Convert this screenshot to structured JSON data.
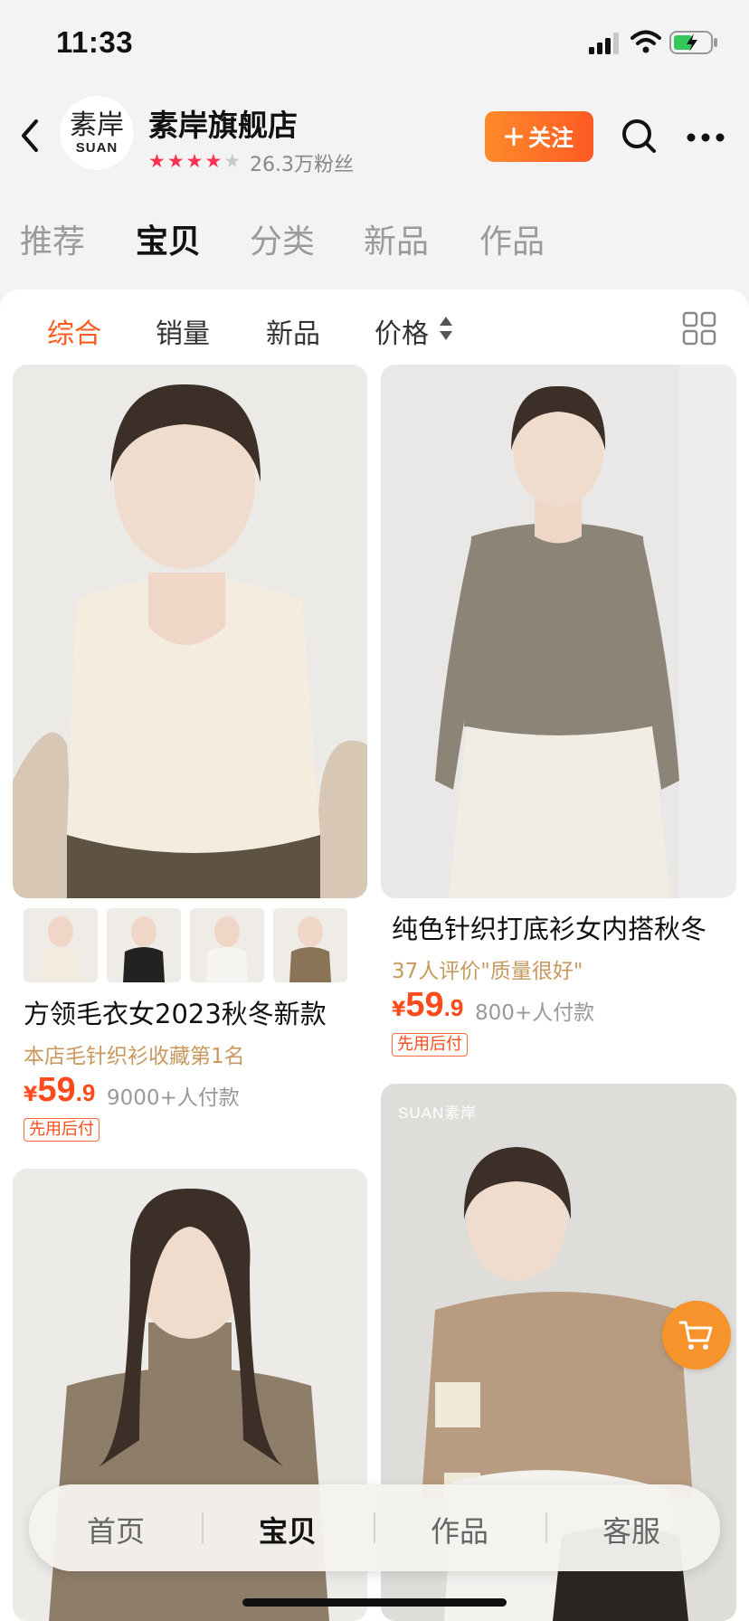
{
  "status_bar": {
    "time": "11:33"
  },
  "store": {
    "logo_cn": "素岸",
    "logo_en": "SUAN",
    "name": "素岸旗舰店",
    "rating_stars": 4,
    "fans": "26.3万粉丝",
    "follow_label": "关注"
  },
  "top_tabs": [
    {
      "label": "推荐",
      "active": false
    },
    {
      "label": "宝贝",
      "active": true
    },
    {
      "label": "分类",
      "active": false
    },
    {
      "label": "新品",
      "active": false
    },
    {
      "label": "作品",
      "active": false
    }
  ],
  "sort_bar": [
    {
      "label": "综合",
      "active": true
    },
    {
      "label": "销量",
      "active": false
    },
    {
      "label": "新品",
      "active": false
    },
    {
      "label": "价格",
      "active": false
    }
  ],
  "products": [
    {
      "title": "方领毛衣女2023秋冬新款",
      "subtitle": "本店毛针织衫收藏第1名",
      "price_symbol": "¥",
      "price_int": "59",
      "price_dec": ".9",
      "paid": "9000+人付款",
      "tag": "先用后付"
    },
    {
      "title": "纯色针织打底衫女内搭秋冬",
      "subtitle": "37人评价\"质量很好\"",
      "price_symbol": "¥",
      "price_int": "59",
      "price_dec": ".9",
      "paid": "800+人付款",
      "tag": "先用后付"
    },
    {
      "watermark": "SUAN素岸"
    }
  ],
  "bottom_nav": [
    {
      "label": "首页",
      "active": false
    },
    {
      "label": "宝贝",
      "active": true
    },
    {
      "label": "作品",
      "active": false
    },
    {
      "label": "客服",
      "active": false
    }
  ],
  "colors": {
    "accent": "#ff5a1f",
    "price": "#ff4a1c",
    "star": "#ff3153",
    "cart_button": "#f7932b"
  }
}
